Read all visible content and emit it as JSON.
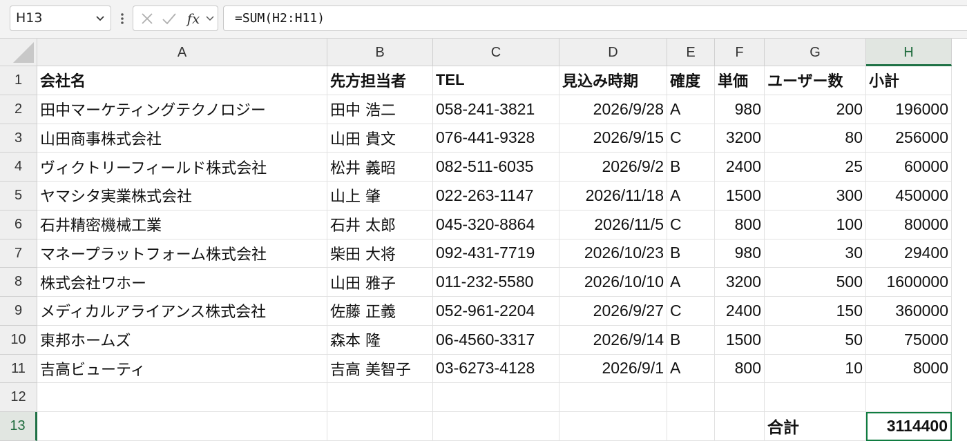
{
  "formula_bar": {
    "name_box": "H13",
    "formula": "=SUM(H2:H11)",
    "fx_label": "fx"
  },
  "columns": [
    "A",
    "B",
    "C",
    "D",
    "E",
    "F",
    "G",
    "H"
  ],
  "rows": [
    {
      "num": "1",
      "cells": [
        "会社名",
        "先方担当者",
        "TEL",
        "見込み時期",
        "確度",
        "単価",
        "ユーザー数",
        "小計"
      ]
    },
    {
      "num": "2",
      "cells": [
        "田中マーケティングテクノロジー",
        "田中 浩二",
        "058-241-3821",
        "2026/9/28",
        "A",
        "980",
        "200",
        "196000"
      ]
    },
    {
      "num": "3",
      "cells": [
        "山田商事株式会社",
        "山田 貴文",
        "076-441-9328",
        "2026/9/15",
        "C",
        "3200",
        "80",
        "256000"
      ]
    },
    {
      "num": "4",
      "cells": [
        "ヴィクトリーフィールド株式会社",
        "松井 義昭",
        "082-511-6035",
        "2026/9/2",
        "B",
        "2400",
        "25",
        "60000"
      ]
    },
    {
      "num": "5",
      "cells": [
        "ヤマシタ実業株式会社",
        "山上 肇",
        "022-263-1147",
        "2026/11/18",
        "A",
        "1500",
        "300",
        "450000"
      ]
    },
    {
      "num": "6",
      "cells": [
        "石井精密機械工業",
        "石井 太郎",
        "045-320-8864",
        "2026/11/5",
        "C",
        "800",
        "100",
        "80000"
      ]
    },
    {
      "num": "7",
      "cells": [
        "マネープラットフォーム株式会社",
        "柴田 大将",
        "092-431-7719",
        "2026/10/23",
        "B",
        "980",
        "30",
        "29400"
      ]
    },
    {
      "num": "8",
      "cells": [
        "株式会社ワホー",
        "山田 雅子",
        "011-232-5580",
        "2026/10/10",
        "A",
        "3200",
        "500",
        "1600000"
      ]
    },
    {
      "num": "9",
      "cells": [
        "メディカルアライアンス株式会社",
        "佐藤 正義",
        "052-961-2204",
        "2026/9/27",
        "C",
        "2400",
        "150",
        "360000"
      ]
    },
    {
      "num": "10",
      "cells": [
        "東邦ホームズ",
        "森本 隆",
        "06-4560-3317",
        "2026/9/14",
        "B",
        "1500",
        "50",
        "75000"
      ]
    },
    {
      "num": "11",
      "cells": [
        "吉高ビューティ",
        "吉高 美智子",
        "03-6273-4128",
        "2026/9/1",
        "A",
        "800",
        "10",
        "8000"
      ]
    },
    {
      "num": "12",
      "cells": [
        "",
        "",
        "",
        "",
        "",
        "",
        "",
        ""
      ]
    },
    {
      "num": "13",
      "cells": [
        "",
        "",
        "",
        "",
        "",
        "",
        "合計",
        "3114400"
      ]
    }
  ],
  "selection": {
    "column": "H",
    "row": "13"
  }
}
